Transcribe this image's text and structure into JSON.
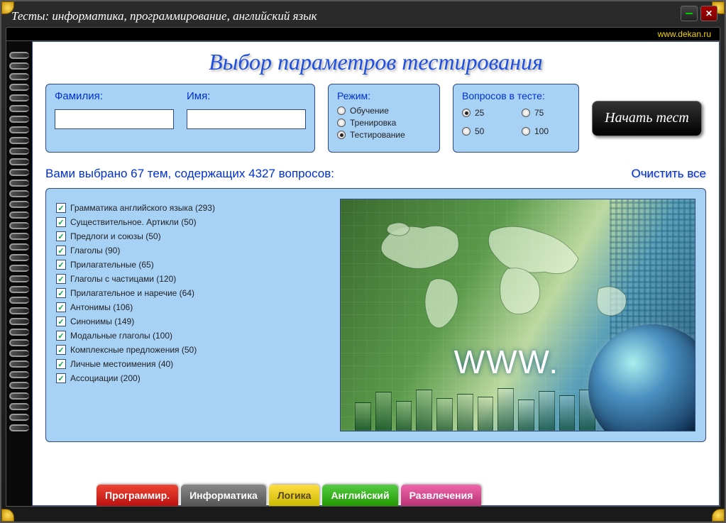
{
  "window": {
    "title": "Тесты:  информатика, программирование, английский язык",
    "url": "www.dekan.ru"
  },
  "page_title": "Выбор параметров тестирования",
  "name": {
    "surname_label": "Фамилия:",
    "name_label": "Имя:",
    "surname_value": "",
    "name_value": ""
  },
  "mode": {
    "title": "Режим:",
    "options": [
      {
        "label": "Обучение",
        "selected": false
      },
      {
        "label": "Тренировка",
        "selected": false
      },
      {
        "label": "Тестирование",
        "selected": true
      }
    ]
  },
  "questions": {
    "title": "Вопросов в тесте:",
    "options": [
      {
        "label": "25",
        "selected": true
      },
      {
        "label": "75",
        "selected": false
      },
      {
        "label": "50",
        "selected": false
      },
      {
        "label": "100",
        "selected": false
      }
    ]
  },
  "start_label": "Начать тест",
  "status": {
    "text": "Вами выбрано 67 тем, содержащих 4327 вопросов:",
    "clear": "Очистить все"
  },
  "topics": [
    {
      "label": "Грамматика английского языка (293)",
      "checked": true
    },
    {
      "label": "Существительное. Артикли (50)",
      "checked": true
    },
    {
      "label": "Предлоги и союзы (50)",
      "checked": true
    },
    {
      "label": "Глаголы (90)",
      "checked": true
    },
    {
      "label": "Прилагательные (65)",
      "checked": true
    },
    {
      "label": "Глаголы с частицами (120)",
      "checked": true
    },
    {
      "label": "Прилагательное и наречие (64)",
      "checked": true
    },
    {
      "label": "Антонимы (106)",
      "checked": true
    },
    {
      "label": "Синонимы (149)",
      "checked": true
    },
    {
      "label": "Модальные глаголы (100)",
      "checked": true
    },
    {
      "label": "Комплексные предложения (50)",
      "checked": true
    },
    {
      "label": "Личные местоимения (40)",
      "checked": true
    },
    {
      "label": "Ассоциации (200)",
      "checked": true
    }
  ],
  "illustration": {
    "www": "WWW."
  },
  "tabs": [
    {
      "label": "Программир.",
      "color": "red"
    },
    {
      "label": "Информатика",
      "color": "gray"
    },
    {
      "label": "Логика",
      "color": "yellow"
    },
    {
      "label": "Английский",
      "color": "green"
    },
    {
      "label": "Развлечения",
      "color": "pink"
    }
  ]
}
